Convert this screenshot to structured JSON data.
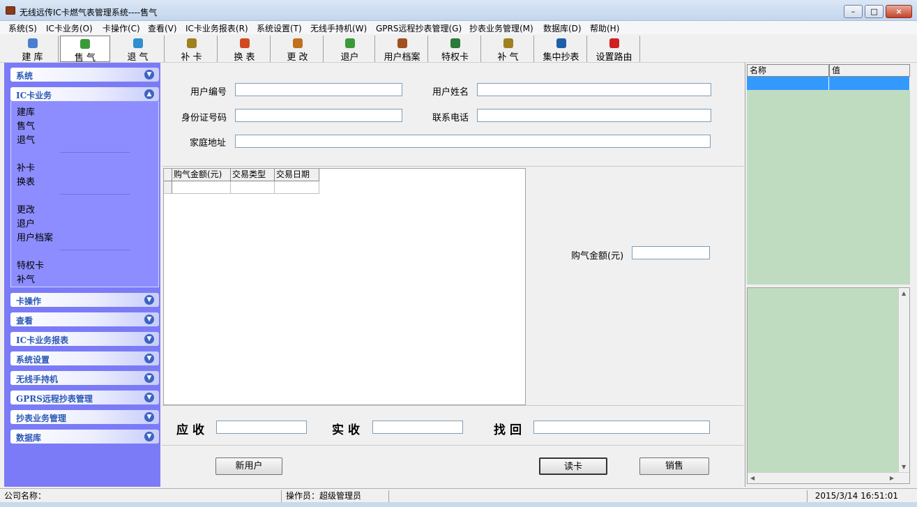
{
  "window": {
    "title": "无线远传IC卡燃气表管理系统----售气",
    "min_label": "–",
    "max_label": "□",
    "close_label": "×"
  },
  "menu": [
    "系统(S)",
    "IC卡业务(O)",
    "卡操作(C)",
    "查看(V)",
    "IC卡业务报表(R)",
    "系统设置(T)",
    "无线手持机(W)",
    "GPRS远程抄表管理(G)",
    "抄表业务管理(M)",
    "数据库(D)",
    "帮助(H)"
  ],
  "toolbar": [
    {
      "label": "建  库",
      "icon": "database-icon",
      "color": "#4a7fd0"
    },
    {
      "label": "售  气",
      "icon": "house-icon",
      "color": "#3a9a3a",
      "active": true
    },
    {
      "label": "退  气",
      "icon": "refresh-icon",
      "color": "#2f8fd0"
    },
    {
      "label": "补  卡",
      "icon": "wand-icon",
      "color": "#a08020"
    },
    {
      "label": "换  表",
      "icon": "power-icon",
      "color": "#d04a20"
    },
    {
      "label": "更  改",
      "icon": "users-icon",
      "color": "#c07020"
    },
    {
      "label": "退户",
      "icon": "house-icon",
      "color": "#3a9a3a"
    },
    {
      "label": "用户档案",
      "icon": "user-file-icon",
      "color": "#a05020"
    },
    {
      "label": "特权卡",
      "icon": "globe-icon",
      "color": "#2a7a3a"
    },
    {
      "label": "补  气",
      "icon": "wand-icon",
      "color": "#a08020"
    },
    {
      "label": "集中抄表",
      "icon": "power-icon",
      "color": "#1f5fa8"
    },
    {
      "label": "设置路由",
      "icon": "stop-icon",
      "color": "#d02020"
    }
  ],
  "sidebar": {
    "sections_top": [
      {
        "title": "系统",
        "expanded": false
      },
      {
        "title": "IC卡业务",
        "expanded": true
      }
    ],
    "ic_items": [
      [
        "建库",
        "售气",
        "退气"
      ],
      [
        "补卡",
        "换表"
      ],
      [
        "更改",
        "退户",
        "用户档案"
      ],
      [
        "特权卡",
        "补气"
      ]
    ],
    "sections_bottom": [
      "卡操作",
      "查看",
      "IC卡业务报表",
      "系统设置",
      "无线手持机",
      "GPRS远程抄表管理",
      "抄表业务管理",
      "数据库"
    ]
  },
  "form": {
    "user_id_label": "用户编号",
    "user_id_value": "",
    "user_name_label": "用户姓名",
    "user_name_value": "",
    "id_card_label": "身份证号码",
    "id_card_value": "",
    "phone_label": "联系电话",
    "phone_value": "",
    "address_label": "家庭地址",
    "address_value": ""
  },
  "grid": {
    "columns": [
      "购气金额(元)",
      "交易类型",
      "交易日期"
    ],
    "rows": [
      [
        "",
        "",
        ""
      ]
    ]
  },
  "purchase": {
    "label": "购气金额(元)",
    "value": ""
  },
  "payment": {
    "due_label": "应收",
    "due_value": "",
    "received_label": "实收",
    "received_value": "",
    "change_label": "找回",
    "change_value": ""
  },
  "buttons": {
    "new_user": "新用户",
    "read_card": "读卡",
    "sell": "销售"
  },
  "property_grid": {
    "name_header": "名称",
    "value_header": "值"
  },
  "status": {
    "company": "公司名称：",
    "operator": "操作员：超级管理员",
    "datetime": "2015/3/14 16:51:01"
  }
}
